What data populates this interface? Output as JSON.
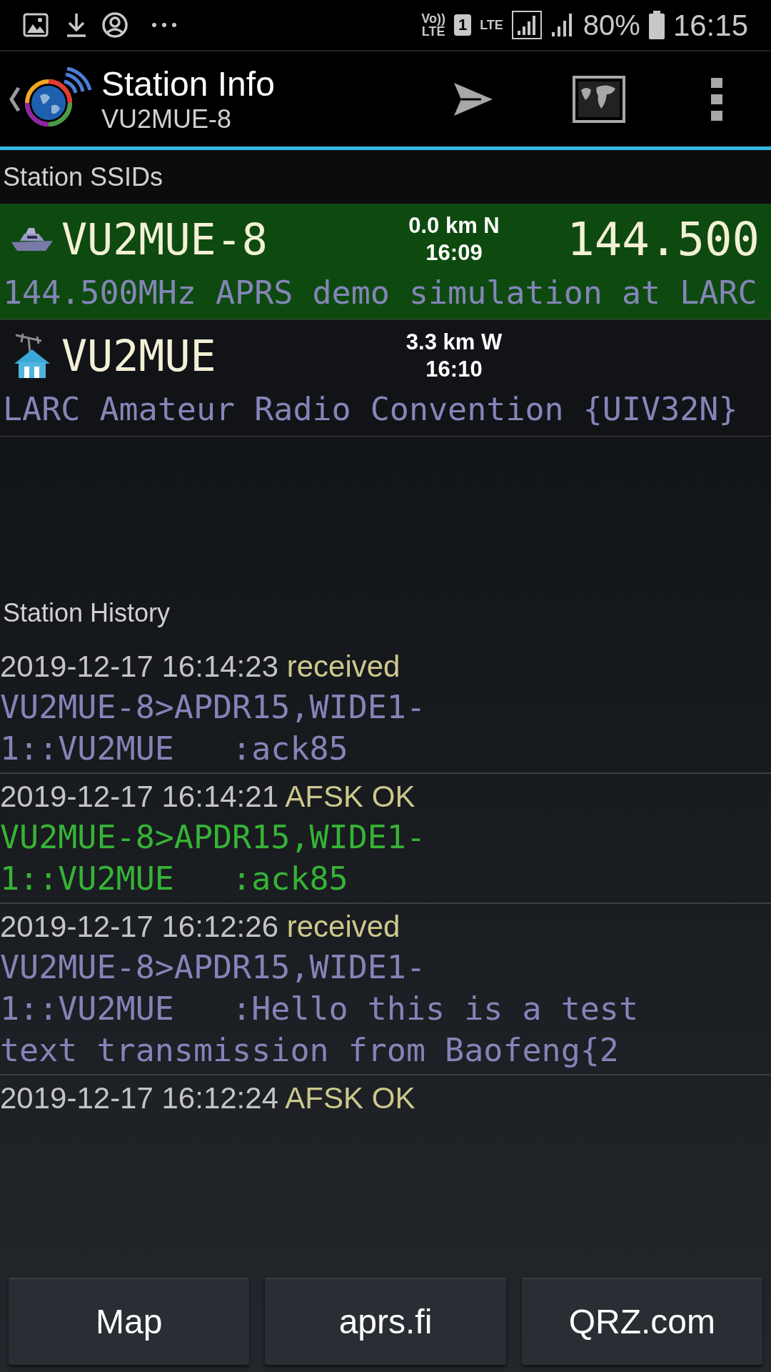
{
  "status_bar": {
    "volte": [
      "Vo))",
      "LTE"
    ],
    "sim": "1",
    "data": "LTE",
    "battery": "80%",
    "time": "16:15"
  },
  "app_bar": {
    "title": "Station Info",
    "subtitle": "VU2MUE-8"
  },
  "ssids": {
    "heading": "Station SSIDs",
    "stations": [
      {
        "kind": "boat",
        "callsign": "VU2MUE-8",
        "distance": "0.0 km N",
        "time": "16:09",
        "frequency": "144.500",
        "comment": "144.500MHz APRS demo simulation at LARC",
        "selected": true
      },
      {
        "kind": "house",
        "callsign": "VU2MUE",
        "distance": "3.3 km W",
        "time": "16:10",
        "comment": "LARC Amateur Radio Convention {UIV32N}",
        "selected": false
      }
    ]
  },
  "history": {
    "heading": "Station History",
    "entries": [
      {
        "timestamp": "2019-12-17 16:14:23",
        "status": "received",
        "packet": "VU2MUE-8>APDR15,WIDE1-\n1::VU2MUE   :ack85",
        "color": "#8484b8"
      },
      {
        "timestamp": "2019-12-17 16:14:21",
        "status": "AFSK OK",
        "packet": "VU2MUE-8>APDR15,WIDE1-\n1::VU2MUE   :ack85",
        "color": "#36b336"
      },
      {
        "timestamp": "2019-12-17 16:12:26",
        "status": "received",
        "packet": "VU2MUE-8>APDR15,WIDE1-\n1::VU2MUE   :Hello this is a test\ntext transmission from Baofeng{2",
        "color": "#8484b8"
      },
      {
        "timestamp": "2019-12-17 16:12:24",
        "status": "AFSK OK"
      }
    ]
  },
  "buttons": [
    "Map",
    "aprs.fi",
    "QRZ.com"
  ]
}
